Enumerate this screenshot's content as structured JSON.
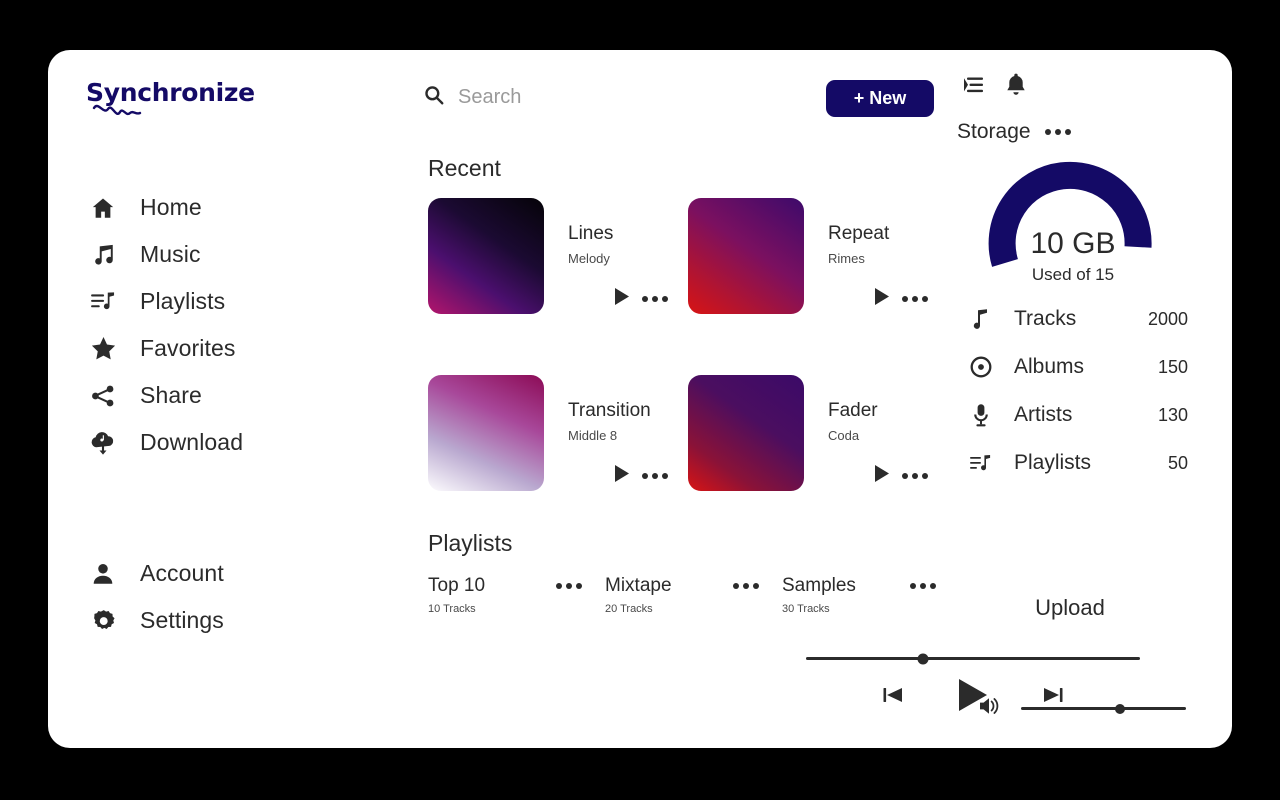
{
  "app": {
    "logo_text": "Synchronize"
  },
  "sidebar": {
    "main_items": [
      {
        "label": "Home",
        "icon": "home-icon"
      },
      {
        "label": "Music",
        "icon": "music-note-icon"
      },
      {
        "label": "Playlists",
        "icon": "playlist-icon"
      },
      {
        "label": "Favorites",
        "icon": "star-icon"
      },
      {
        "label": "Share",
        "icon": "share-icon"
      },
      {
        "label": "Download",
        "icon": "cloud-download-icon"
      }
    ],
    "bottom_items": [
      {
        "label": "Account",
        "icon": "user-icon"
      },
      {
        "label": "Settings",
        "icon": "gear-icon"
      }
    ]
  },
  "header": {
    "search_placeholder": "Search",
    "search_value": "",
    "new_label": "+ New",
    "menu_icon": "list-collapse-icon",
    "bell_icon": "bell-icon"
  },
  "main": {
    "recent_title": "Recent",
    "playlists_title": "Playlists",
    "recent": [
      {
        "name": "Lines",
        "subtitle": "Melody",
        "gradient": "linear-gradient(215deg, #050308 0%, #1b0a32 38%, #4b0f6e 66%, #b3156b 100%)"
      },
      {
        "name": "Repeat",
        "subtitle": "Rimes",
        "gradient": "linear-gradient(215deg, #3d0a6b 0%, #7b1060 45%, #b31430 78%, #d81414 100%)"
      },
      {
        "name": "Transition",
        "subtitle": "Middle 8",
        "gradient": "linear-gradient(205deg, #8c0b56 0%, #a8489a 35%, #b9a8cf 68%, #fdfcfe 100%)"
      },
      {
        "name": "Fader",
        "subtitle": "Coda",
        "gradient": "linear-gradient(215deg, #3b0a68 0%, #4b0e60 40%, #8a1238 75%, #d81414 100%)"
      }
    ],
    "playlists": [
      {
        "name": "Top 10",
        "count": "10 Tracks"
      },
      {
        "name": "Mixtape",
        "count": "20 Tracks"
      },
      {
        "name": "Samples",
        "count": "30 Tracks"
      }
    ]
  },
  "player": {
    "progress_percent": 35,
    "previous_icon": "skip-previous-icon",
    "play_icon": "play-icon",
    "next_icon": "skip-next-icon"
  },
  "storage": {
    "title": "Storage",
    "value": "10 GB",
    "subtitle": "Used of 15",
    "gauge_percent": 67,
    "gauge_color": "#140a66",
    "stats": [
      {
        "label": "Tracks",
        "value": "2000",
        "icon": "music-note-icon"
      },
      {
        "label": "Albums",
        "value": "150",
        "icon": "album-disc-icon"
      },
      {
        "label": "Artists",
        "value": "130",
        "icon": "microphone-icon"
      },
      {
        "label": "Playlists",
        "value": "50",
        "icon": "playlist-icon"
      }
    ],
    "upload_label": "Upload"
  },
  "volume": {
    "level_percent": 60,
    "icon": "speaker-icon"
  }
}
